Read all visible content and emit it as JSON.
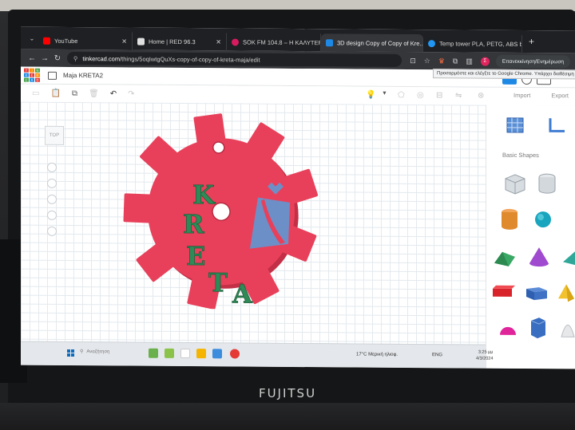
{
  "browser": {
    "tabs": [
      {
        "title": "YouTube",
        "favicon_color": "#ff0000"
      },
      {
        "title": "Home | RED 96.3",
        "favicon_color": "#d0d0d0"
      },
      {
        "title": "SOK FM 104.8 – Η ΚΑΛΥΤΕΡΗ ...",
        "favicon_color": "#d81b60"
      },
      {
        "title": "3D design Copy of Copy of Kre...",
        "favicon_color": "#1e88e5",
        "active": true
      },
      {
        "title": "Temp tower PLA, PETG, ABS by...",
        "favicon_color": "#2196f3"
      }
    ],
    "new_tab_glyph": "+",
    "url_host": "tinkercad.com",
    "url_path": "/things/5oqIwtgQuXs-copy-of-copy-of-kreta-maja/edit",
    "relaunch_label": "Επανεκκίνηση/Ενημέρωση",
    "tooltip": "Προσαρμόστε και ελέγξτε το Google Chrome. Υπάρχει διαθέσιμη ενημέρωση"
  },
  "tinkercad": {
    "logo_letters": [
      "T",
      "I",
      "N",
      "K",
      "E",
      "R",
      "C",
      "A",
      "D"
    ],
    "design_title": "Maja KRETA2",
    "import_label": "Import",
    "export_label": "Export",
    "viewcube_label": "TOP",
    "basic_shapes_label": "Basic Shapes",
    "design_text": [
      "K",
      "R",
      "E",
      "T",
      "A"
    ]
  },
  "taskbar": {
    "search_placeholder": "Αναζήτηση",
    "weather": "17°C  Μερική ηλιοφ.",
    "language": "ENG",
    "time": "3:25 μμ",
    "date": "4/3/2024"
  },
  "monitor_brand": "FUJITSU",
  "colors": {
    "gear_red": "#e8405a",
    "letter_green": "#2e8b57",
    "logo_blue": "#6d8fc7"
  }
}
